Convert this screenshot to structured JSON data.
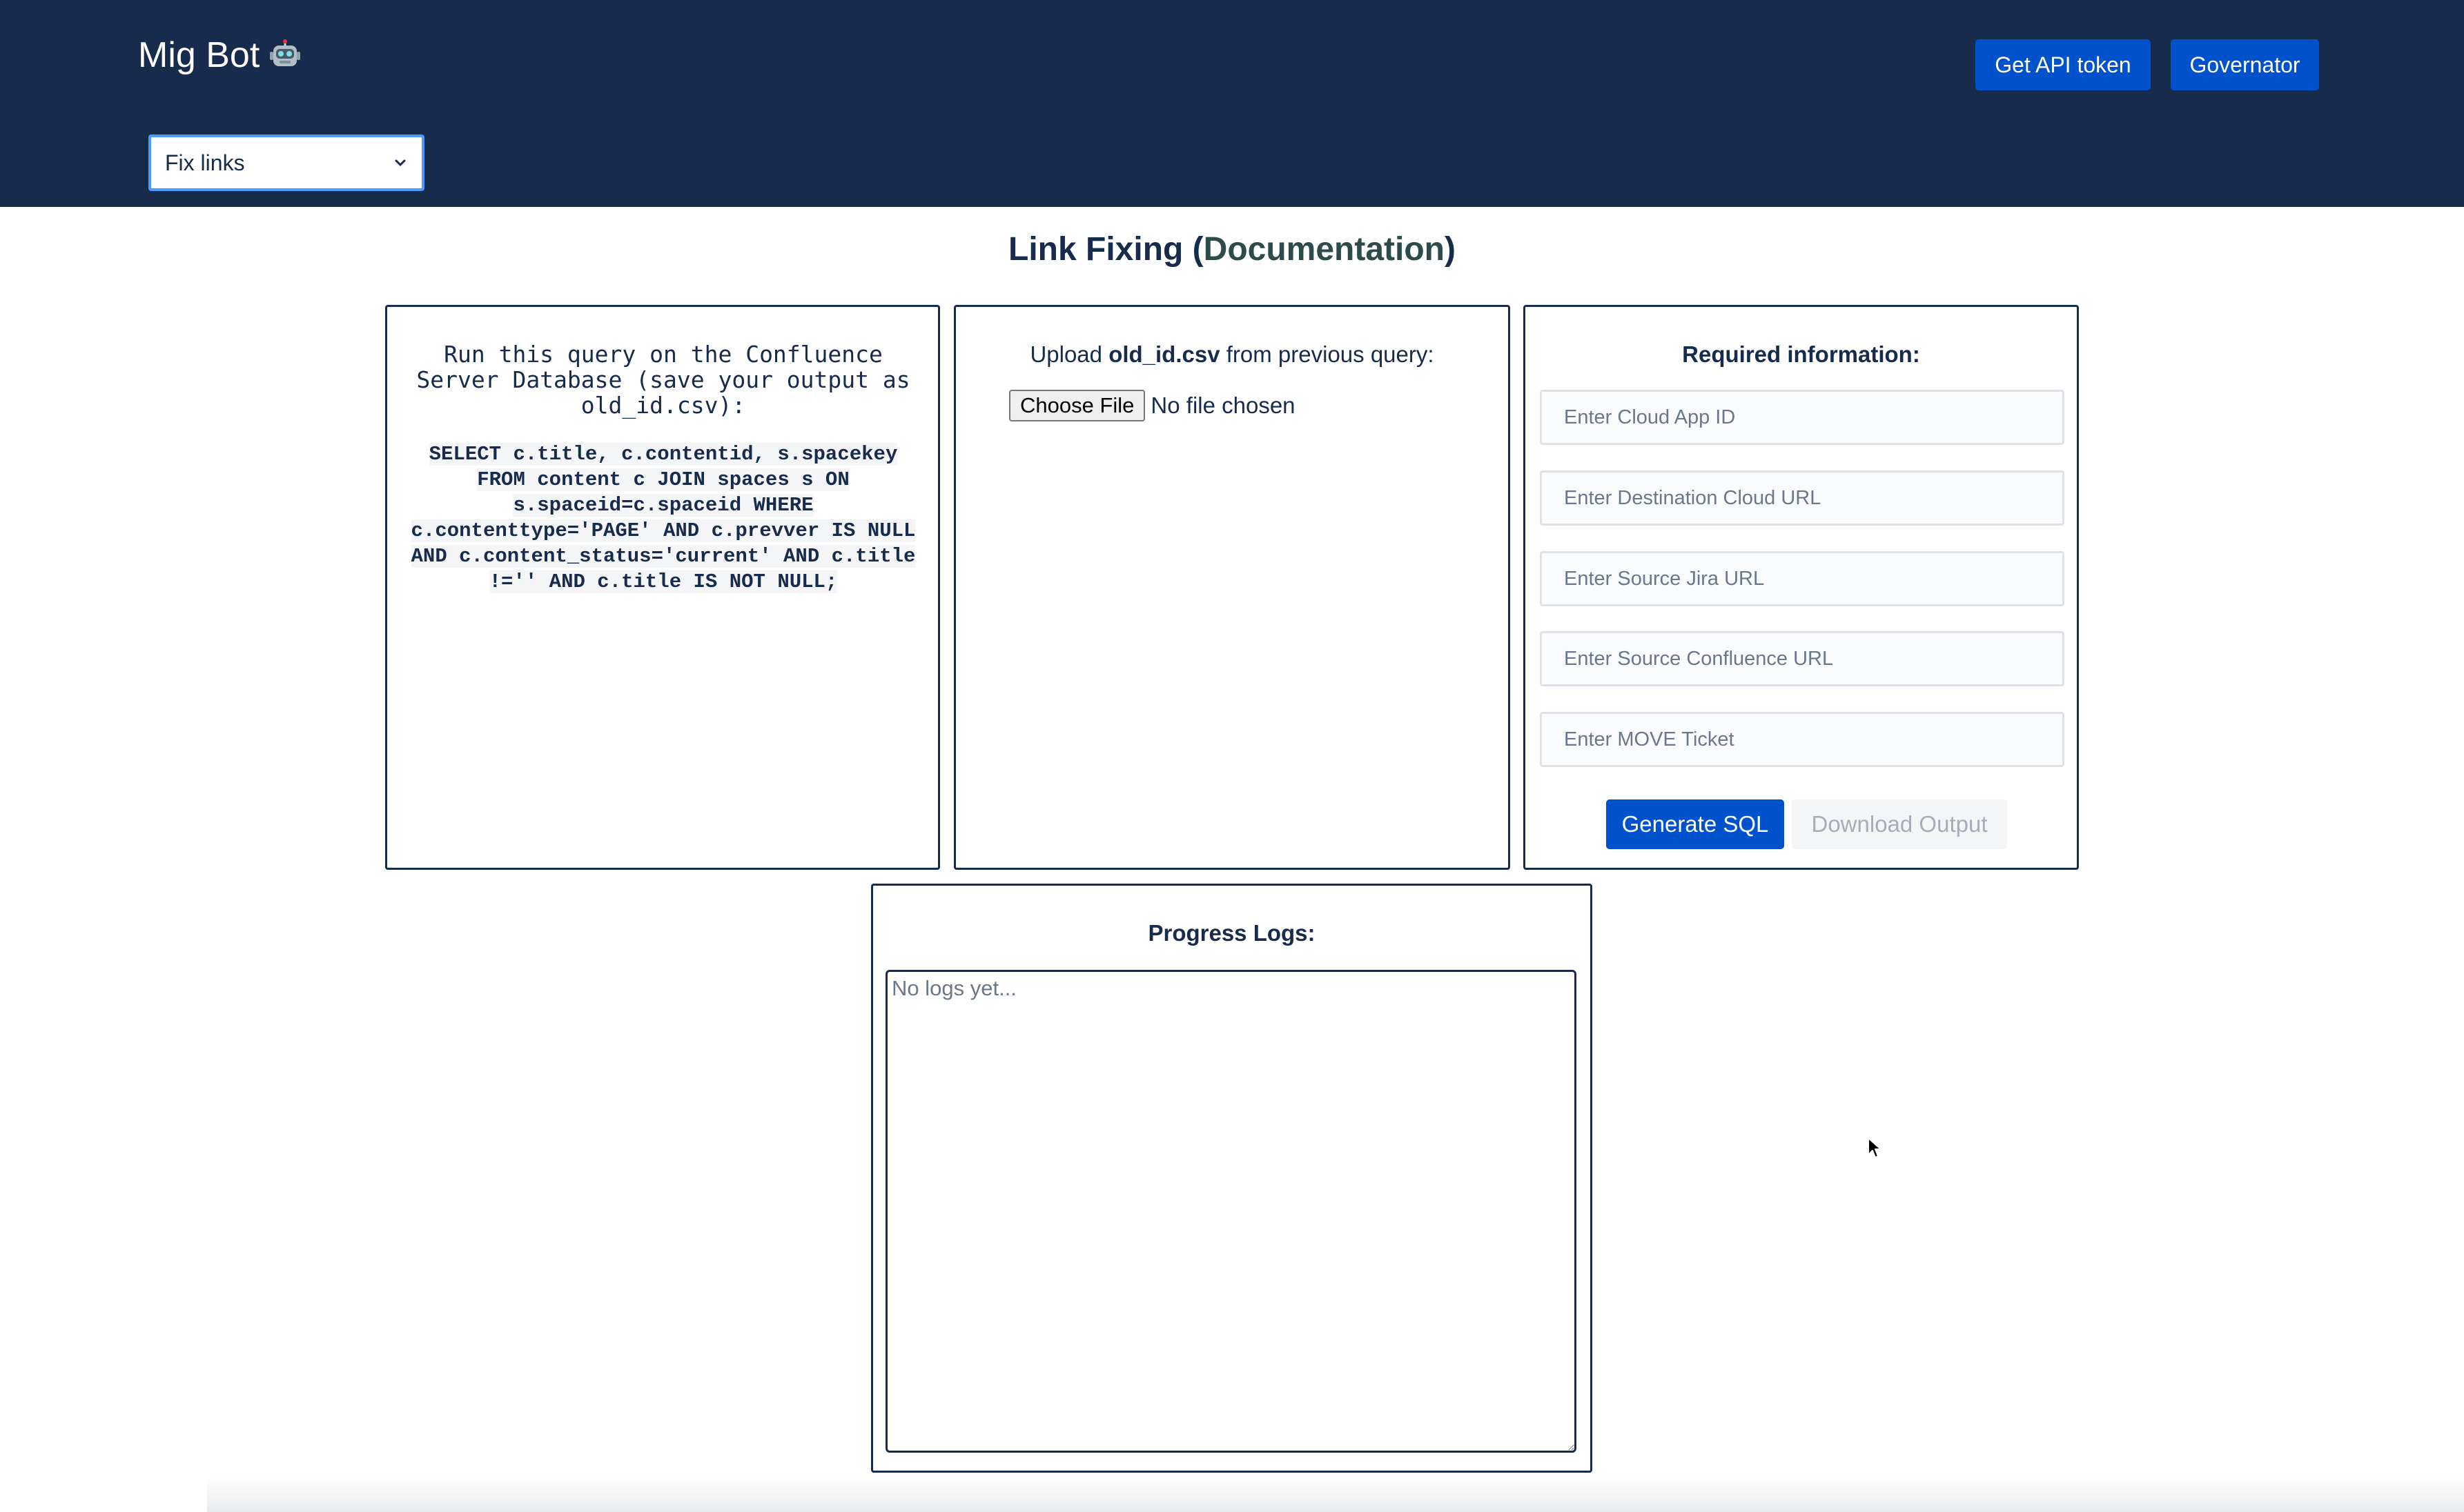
{
  "app": {
    "title": "Mig Bot",
    "logo_icon": "robot-emoji-icon"
  },
  "header": {
    "get_token_label": "Get API token",
    "governator_label": "Governator",
    "tool_select": {
      "value": "Fix links",
      "icon": "chevron-down-icon"
    }
  },
  "page": {
    "title_prefix": "Link Fixing (",
    "title_link": "Documentation",
    "title_suffix": ")"
  },
  "query_panel": {
    "intro": "Run this query on the Confluence Server Database (save your output as old_id.csv):",
    "sql_lines": [
      "SELECT c.title, c.contentid, s.spacekey",
      "FROM content c JOIN spaces s ON",
      "s.spaceid=c.spaceid WHERE",
      "c.contenttype='PAGE' AND c.prevver IS NULL",
      "AND c.content_status='current' AND c.title",
      "!='' AND c.title IS NOT NULL;"
    ]
  },
  "upload_panel": {
    "label_prefix": "Upload ",
    "label_file": "old_id.csv",
    "label_suffix": " from previous query:",
    "choose_file_label": "Choose File",
    "file_status": "No file chosen"
  },
  "info_panel": {
    "title": "Required information:",
    "fields": [
      {
        "placeholder": "Enter Cloud App ID",
        "value": ""
      },
      {
        "placeholder": "Enter Destination Cloud URL",
        "value": ""
      },
      {
        "placeholder": "Enter Source Jira URL",
        "value": ""
      },
      {
        "placeholder": "Enter Source Confluence URL",
        "value": ""
      },
      {
        "placeholder": "Enter MOVE Ticket",
        "value": ""
      }
    ],
    "generate_label": "Generate SQL",
    "download_label": "Download Output"
  },
  "logs_panel": {
    "title": "Progress Logs:",
    "placeholder": "No logs yet..."
  },
  "colors": {
    "header_bg": "#172b4d",
    "primary_button": "#0052cc",
    "select_focus": "#4c9aff",
    "documentation_link": "#2d4b4a"
  }
}
